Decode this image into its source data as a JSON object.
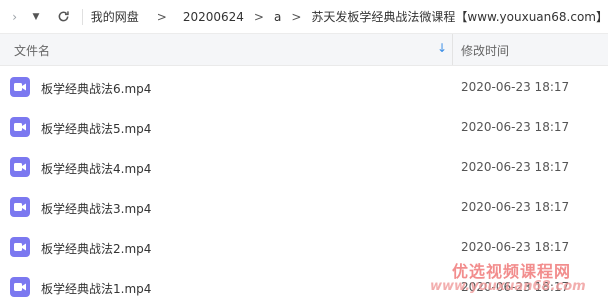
{
  "breadcrumb": {
    "items": [
      "我的网盘",
      "20200624",
      "a",
      "苏天发板学经典战法微课程【www.youxuan68.com】"
    ],
    "separator": ">"
  },
  "header": {
    "name_col": "文件名",
    "date_col": "修改时间"
  },
  "files": [
    {
      "name": "板学经典战法6.mp4",
      "date": "2020-06-23 18:17"
    },
    {
      "name": "板学经典战法5.mp4",
      "date": "2020-06-23 18:17"
    },
    {
      "name": "板学经典战法4.mp4",
      "date": "2020-06-23 18:17"
    },
    {
      "name": "板学经典战法3.mp4",
      "date": "2020-06-23 18:17"
    },
    {
      "name": "板学经典战法2.mp4",
      "date": "2020-06-23 18:17"
    },
    {
      "name": "板学经典战法1.mp4",
      "date": "2020-06-23 18:17"
    }
  ],
  "watermark": {
    "text": "优选视频课程网",
    "url": "www.youxuan68.com"
  },
  "colors": {
    "video_icon": "#7b78f0",
    "sort_arrow": "#3b8ee6",
    "watermark": "#f07a7a"
  }
}
